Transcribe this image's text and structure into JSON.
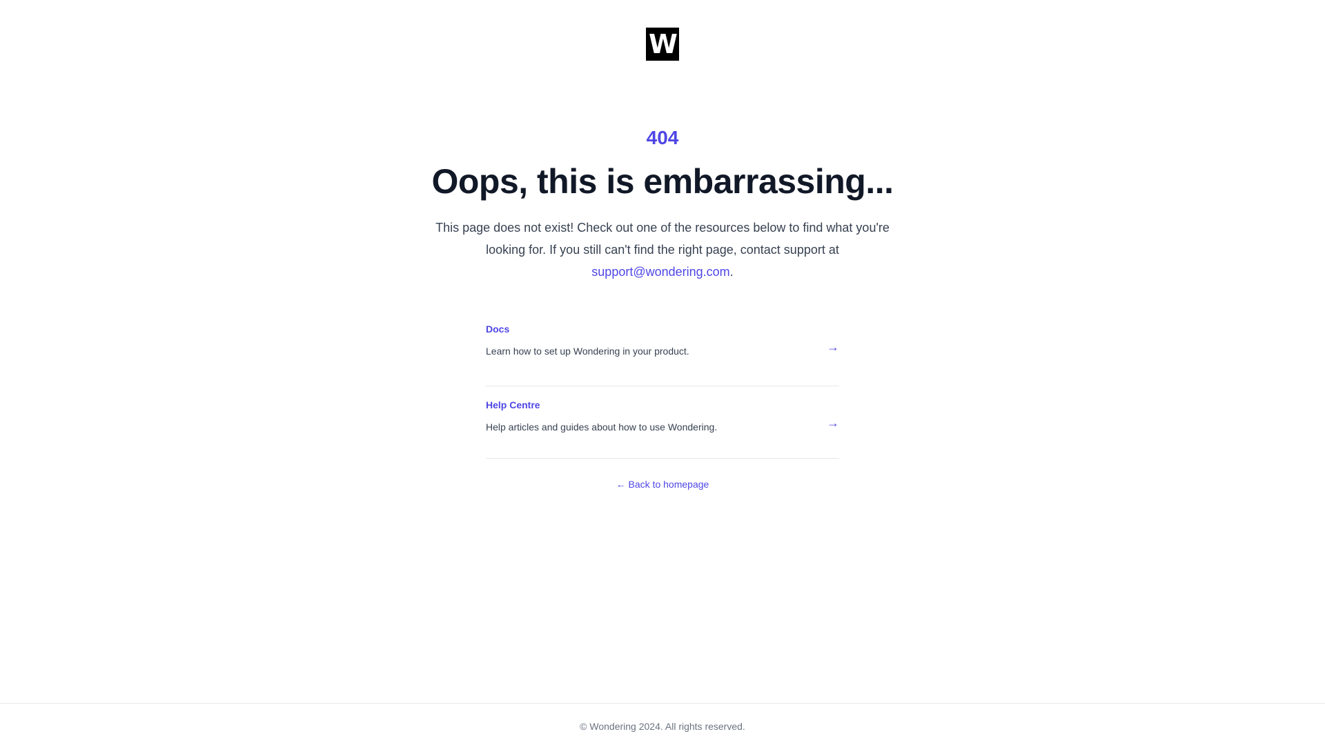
{
  "brand": {
    "logo_letter": "W",
    "logo_color": "#000000",
    "accent_color": "#4f46e5"
  },
  "error": {
    "code": "404",
    "title": "Oops, this is embarrassing...",
    "description": "This page does not exist! Check out one of the resources below to find what you're looking for. If you still can't find the right page, contact support at",
    "support_email": "support@wondering.com",
    "description_end": "."
  },
  "resources": [
    {
      "title": "Docs",
      "description": "Learn how to set up Wondering in your product.",
      "arrow": "→",
      "icon": "arrow-right-icon"
    },
    {
      "title": "Help Centre",
      "description": "Help articles and guides about how to use Wondering.",
      "arrow": "→",
      "icon": "arrow-right-icon"
    }
  ],
  "back_link": {
    "label": "← Back to homepage"
  },
  "footer": {
    "text": "© Wondering 2024. All rights reserved."
  }
}
